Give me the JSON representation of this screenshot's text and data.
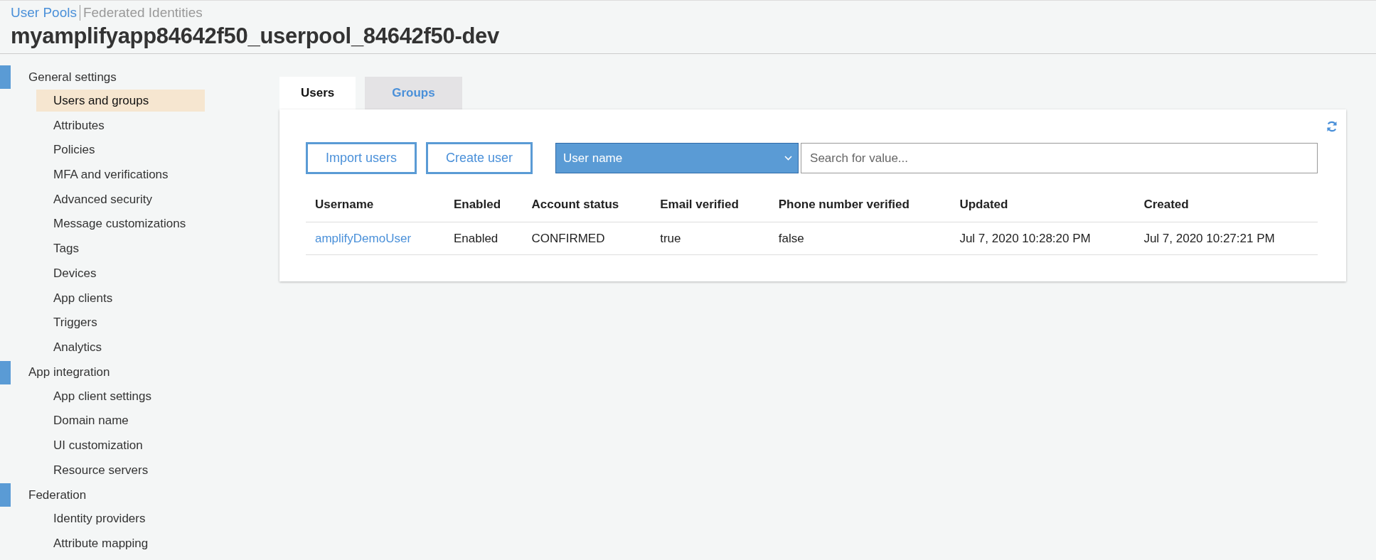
{
  "breadcrumb": [
    {
      "label": "User Pools",
      "selected": true
    },
    {
      "label": "Federated Identities",
      "selected": false
    }
  ],
  "title": "myamplifyapp84642f50_userpool_84642f50-dev",
  "sidebar": {
    "sections": [
      {
        "label": "General settings",
        "items": [
          {
            "label": "Users and groups",
            "selected": true
          },
          {
            "label": "Attributes",
            "selected": false
          },
          {
            "label": "Policies",
            "selected": false
          },
          {
            "label": "MFA and verifications",
            "selected": false
          },
          {
            "label": "Advanced security",
            "selected": false
          },
          {
            "label": "Message customizations",
            "selected": false
          },
          {
            "label": "Tags",
            "selected": false
          },
          {
            "label": "Devices",
            "selected": false
          },
          {
            "label": "App clients",
            "selected": false
          },
          {
            "label": "Triggers",
            "selected": false
          },
          {
            "label": "Analytics",
            "selected": false
          }
        ]
      },
      {
        "label": "App integration",
        "items": [
          {
            "label": "App client settings",
            "selected": false
          },
          {
            "label": "Domain name",
            "selected": false
          },
          {
            "label": "UI customization",
            "selected": false
          },
          {
            "label": "Resource servers",
            "selected": false
          }
        ]
      },
      {
        "label": "Federation",
        "items": [
          {
            "label": "Identity providers",
            "selected": false
          },
          {
            "label": "Attribute mapping",
            "selected": false
          }
        ]
      }
    ]
  },
  "tabs": [
    {
      "label": "Users",
      "selected": true
    },
    {
      "label": "Groups",
      "selected": false
    }
  ],
  "buttons": [
    "Import users",
    "Create user"
  ],
  "filter": {
    "value": "User name"
  },
  "search": {
    "placeholder": "Search for value..."
  },
  "table": {
    "columns": [
      "Username",
      "Enabled",
      "Account status",
      "Email verified",
      "Phone number verified",
      "Updated",
      "Created"
    ],
    "rows": [
      {
        "cells": [
          "amplifyDemoUser",
          "Enabled",
          "CONFIRMED",
          "true",
          "false",
          "Jul 7, 2020 10:28:20 PM",
          "Jul 7, 2020 10:27:21 PM"
        ]
      }
    ]
  }
}
